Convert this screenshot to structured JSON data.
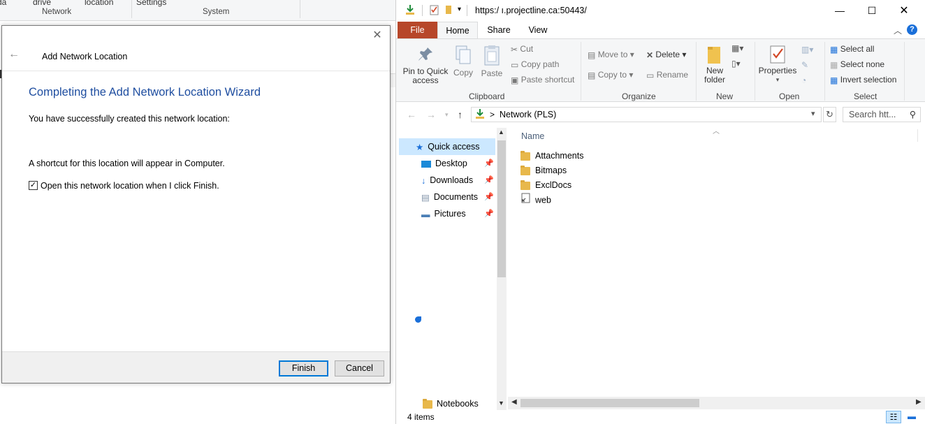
{
  "background_window": {
    "ribbon_cut_items": [
      "da",
      "drive",
      "location",
      "Settings"
    ],
    "groups": [
      "Network",
      "System"
    ]
  },
  "dialog": {
    "title": "Add Network Location",
    "heading": "Completing the Add Network Location Wizard",
    "success_text": "You have successfully created this network location:",
    "shortcut_text": "A shortcut for this location will appear in Computer.",
    "checkbox_label": "Open this network location when I click Finish.",
    "checkbox_checked": true,
    "finish_label": "Finish",
    "cancel_label": "Cancel"
  },
  "explorer": {
    "title": "https:/          ı.projectline.ca:50443/",
    "tabs": {
      "file": "File",
      "home": "Home",
      "share": "Share",
      "view": "View"
    },
    "ribbon": {
      "clipboard": {
        "pin": "Pin to Quick access",
        "copy": "Copy",
        "paste": "Paste",
        "cut": "Cut",
        "copy_path": "Copy path",
        "paste_shortcut": "Paste shortcut",
        "label": "Clipboard"
      },
      "organize": {
        "move_to": "Move to",
        "copy_to": "Copy to",
        "delete": "Delete",
        "rename": "Rename",
        "label": "Organize"
      },
      "new": {
        "new_folder": "New folder",
        "label": "New"
      },
      "open": {
        "properties": "Properties",
        "label": "Open"
      },
      "select": {
        "select_all": "Select all",
        "select_none": "Select none",
        "invert": "Invert selection",
        "label": "Select"
      }
    },
    "address": {
      "breadcrumb": "Network (PLS)",
      "separator": ">"
    },
    "search_placeholder": "Search htt...",
    "nav_pane": {
      "quick_access": "Quick access",
      "items": [
        {
          "label": "Desktop",
          "icon": "desktop-icon",
          "pinned": true
        },
        {
          "label": "Downloads",
          "icon": "downloads-icon",
          "pinned": true
        },
        {
          "label": "Documents",
          "icon": "documents-icon",
          "pinned": true
        },
        {
          "label": "Pictures",
          "icon": "pictures-icon",
          "pinned": true
        }
      ],
      "notebooks": "Notebooks"
    },
    "content": {
      "column_name": "Name",
      "files": [
        {
          "name": "Attachments",
          "type": "folder"
        },
        {
          "name": "Bitmaps",
          "type": "folder"
        },
        {
          "name": "ExclDocs",
          "type": "folder"
        },
        {
          "name": "web",
          "type": "file"
        }
      ]
    },
    "status": "4 items",
    "colors": {
      "file_tab": "#b7472a",
      "heading": "#1f4ea0",
      "selection": "#cce8ff"
    }
  }
}
